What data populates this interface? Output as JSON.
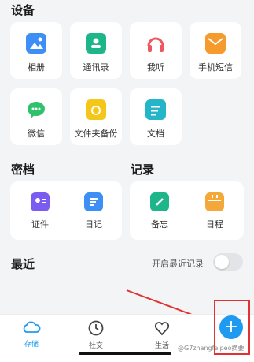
{
  "sections": {
    "devices": "设备",
    "vault": "密档",
    "notes": "记录",
    "recent": "最近"
  },
  "devices": [
    {
      "label": "相册",
      "icon": "photo-album-icon",
      "color": "#3d8ff5"
    },
    {
      "label": "通讯录",
      "icon": "contacts-icon",
      "color": "#1fb58b"
    },
    {
      "label": "我听",
      "icon": "headphones-icon",
      "color": "#f0565f"
    },
    {
      "label": "手机短信",
      "icon": "message-mail-icon",
      "color": "#f59a2c"
    },
    {
      "label": "微信",
      "icon": "wechat-icon",
      "color": "#2fc16b"
    },
    {
      "label": "文件夹备份",
      "icon": "folder-backup-icon",
      "color": "#f5c518"
    },
    {
      "label": "文档",
      "icon": "document-icon",
      "color": "#24b6c8"
    }
  ],
  "vault": [
    {
      "label": "证件",
      "icon": "id-card-icon",
      "color": "#7b5cf0"
    },
    {
      "label": "日记",
      "icon": "diary-icon",
      "color": "#3d8ff5"
    }
  ],
  "notes": [
    {
      "label": "备忘",
      "icon": "memo-icon",
      "color": "#1fb58b"
    },
    {
      "label": "日程",
      "icon": "calendar-icon",
      "color": "#f5a83a"
    }
  ],
  "recent_toggle_label": "开启最近记录",
  "tabs": [
    {
      "label": "存储",
      "icon": "cloud-icon",
      "active": true
    },
    {
      "label": "社交",
      "icon": "clock-icon",
      "active": false
    },
    {
      "label": "生活",
      "icon": "heart-icon",
      "active": false
    }
  ],
  "fab_symbol": "+",
  "watermark": "@G7zhangfeipeo摘要",
  "accent": "#1e9bf0"
}
